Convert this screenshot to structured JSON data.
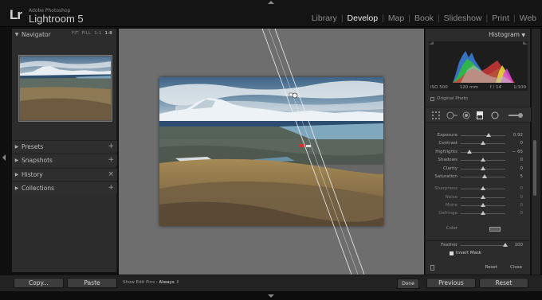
{
  "app": {
    "brand_mark": "Lr",
    "vendor": "Adobe Photoshop",
    "name": "Lightroom 5"
  },
  "modules": [
    {
      "label": "Library",
      "active": false
    },
    {
      "label": "Develop",
      "active": true
    },
    {
      "label": "Map",
      "active": false
    },
    {
      "label": "Book",
      "active": false
    },
    {
      "label": "Slideshow",
      "active": false
    },
    {
      "label": "Print",
      "active": false
    },
    {
      "label": "Web",
      "active": false
    }
  ],
  "left_panel": {
    "navigator": {
      "title": "Navigator",
      "zoom_options": [
        "FIT",
        "FILL",
        "1:1"
      ],
      "zoom_selected": "1:8"
    },
    "sections": [
      {
        "label": "Presets",
        "action": "+"
      },
      {
        "label": "Snapshots",
        "action": "+"
      },
      {
        "label": "History",
        "action": "×"
      },
      {
        "label": "Collections",
        "action": "+"
      }
    ],
    "copy_label": "Copy...",
    "paste_label": "Paste"
  },
  "center": {
    "show_edit_pins_label": "Show Edit Pins :",
    "show_edit_pins_value": "Always",
    "done_label": "Done"
  },
  "right_panel": {
    "histogram_title": "Histogram",
    "camera_info": {
      "iso": "ISO 500",
      "focal": "120 mm",
      "aperture": "f / 14",
      "shutter": "1/100"
    },
    "original_photo_label": "Original Photo",
    "sliders_group1": [
      {
        "label": "Exposure",
        "value": "0.92",
        "level": 0.62
      },
      {
        "label": "Contrast",
        "value": "0",
        "level": 0.5
      },
      {
        "label": "Highlights",
        "value": "− 65",
        "level": 0.2
      },
      {
        "label": "Shadows",
        "value": "0",
        "level": 0.5
      },
      {
        "label": "Clarity",
        "value": "0",
        "level": 0.5
      },
      {
        "label": "Saturation",
        "value": "5",
        "level": 0.53
      }
    ],
    "sliders_group2": [
      {
        "label": "Sharpness",
        "value": "0",
        "level": 0.5
      },
      {
        "label": "Noise",
        "value": "0",
        "level": 0.5
      },
      {
        "label": "Moire",
        "value": "0",
        "level": 0.5
      },
      {
        "label": "Defringe",
        "value": "0",
        "level": 0.5
      }
    ],
    "color_label": "Color",
    "feather_label": "Feather",
    "feather_value": "100",
    "feather_level": 1.0,
    "invert_mask_label": "Invert Mask",
    "reset_label": "Reset",
    "close_label": "Close",
    "previous_label": "Previous",
    "reset_button_label": "Reset"
  },
  "colors": {
    "accent_tool": "#e8e8e8",
    "center_bg": "#6e6e6e",
    "panel_bg": "#2c2c2c"
  }
}
